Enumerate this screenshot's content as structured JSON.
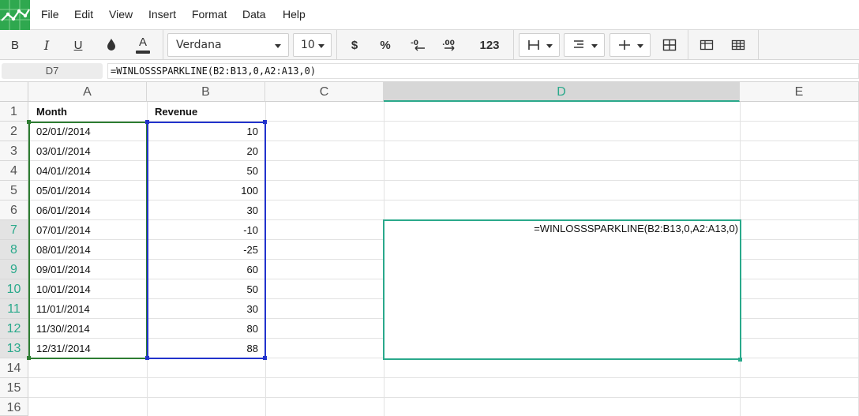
{
  "menu": {
    "items": [
      "File",
      "Edit",
      "View",
      "Insert",
      "Format",
      "Data",
      "Help"
    ]
  },
  "toolbar": {
    "bold": "B",
    "italic": "I",
    "underline": "U",
    "font_color_glyph": "A",
    "font_name": "Verdana",
    "font_size": "10",
    "currency": "$",
    "percent": "%",
    "decrease_decimals": "-0",
    "increase_decimals": ".00",
    "number_format": "123"
  },
  "formula_bar": {
    "cell_ref": "D7",
    "formula": "=WINLOSSSPARKLINE(B2:B13,0,A2:A13,0)"
  },
  "columns": [
    "A",
    "B",
    "C",
    "D",
    "E"
  ],
  "rows": [
    "1",
    "2",
    "3",
    "4",
    "5",
    "6",
    "7",
    "8",
    "9",
    "10",
    "11",
    "12",
    "13",
    "14",
    "15",
    "16"
  ],
  "sheet": {
    "header_month": "Month",
    "header_revenue": "Revenue",
    "data": [
      {
        "month": "02/01//2014",
        "revenue": "10"
      },
      {
        "month": "03/01//2014",
        "revenue": "20"
      },
      {
        "month": "04/01//2014",
        "revenue": "50"
      },
      {
        "month": "05/01//2014",
        "revenue": "100"
      },
      {
        "month": "06/01//2014",
        "revenue": "30"
      },
      {
        "month": "07/01//2014",
        "revenue": "-10"
      },
      {
        "month": "08/01//2014",
        "revenue": "-25"
      },
      {
        "month": "09/01//2014",
        "revenue": "60"
      },
      {
        "month": "10/01//2014",
        "revenue": "50"
      },
      {
        "month": "11/01//2014",
        "revenue": "30"
      },
      {
        "month": "11/30//2014",
        "revenue": "80"
      },
      {
        "month": "12/31//2014",
        "revenue": "88"
      }
    ],
    "d7_formula": "=WINLOSSSPARKLINE(B2:B13,0,A2:A13,0)"
  },
  "colors": {
    "accent": "#2aa98b",
    "range_a": "#2e7d32",
    "range_b": "#2233cc",
    "logo": "#2fa84f"
  }
}
